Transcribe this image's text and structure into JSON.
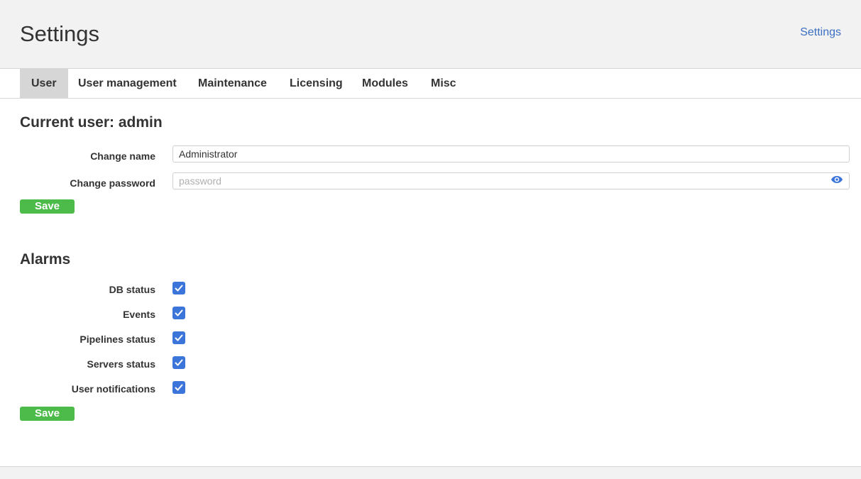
{
  "header": {
    "title": "Settings",
    "breadcrumb": "Settings"
  },
  "tabs": [
    {
      "label": "User",
      "active": true
    },
    {
      "label": "User management",
      "active": false
    },
    {
      "label": "Maintenance",
      "active": false
    },
    {
      "label": "Licensing",
      "active": false
    },
    {
      "label": "Modules",
      "active": false
    },
    {
      "label": "Misc",
      "active": false
    }
  ],
  "user_section": {
    "title": "Current user: admin",
    "name_label": "Change name",
    "name_value": "Administrator",
    "password_label": "Change password",
    "password_placeholder": "password",
    "save_label": "Save",
    "password_toggle_icon": "eye-icon"
  },
  "alarms": {
    "title": "Alarms",
    "items": [
      {
        "label": "DB status",
        "checked": true
      },
      {
        "label": "Events",
        "checked": true
      },
      {
        "label": "Pipelines status",
        "checked": true
      },
      {
        "label": "Servers status",
        "checked": true
      },
      {
        "label": "User notifications",
        "checked": true
      }
    ],
    "save_label": "Save"
  },
  "colors": {
    "accent": "#3b75d9",
    "link": "#3b6fc4",
    "save": "#4cbb4a",
    "header_bg": "#f2f2f2",
    "active_tab_bg": "#d6d6d6"
  }
}
